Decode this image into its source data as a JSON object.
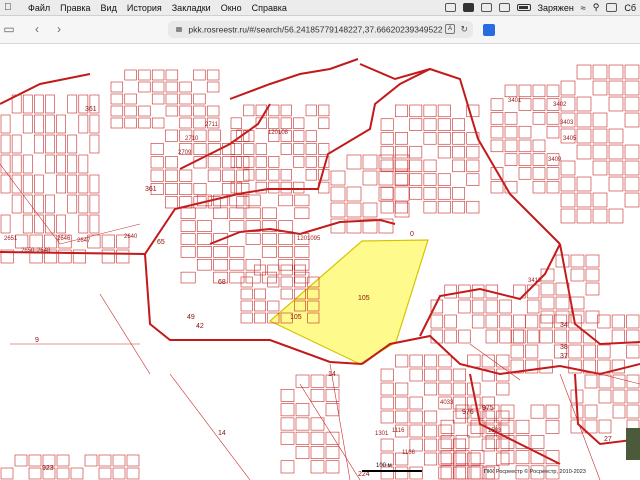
{
  "menubar": {
    "items": [
      "Файл",
      "Правка",
      "Вид",
      "История",
      "Закладки",
      "Окно",
      "Справка"
    ],
    "battery_text": "Заряжен",
    "right_clip": "Сб"
  },
  "browser": {
    "url": "pkk.rosreestr.ru/#/search/56.24185779148227,37.66620239349522"
  },
  "map": {
    "parcel_labels": [
      {
        "text": "361"
      },
      {
        "text": "361"
      },
      {
        "text": "65"
      },
      {
        "text": "9"
      },
      {
        "text": "14"
      },
      {
        "text": "14"
      },
      {
        "text": "105"
      },
      {
        "text": "105"
      },
      {
        "text": "0"
      },
      {
        "text": "68"
      },
      {
        "text": "42"
      },
      {
        "text": "49"
      },
      {
        "text": "2640"
      },
      {
        "text": "2646"
      },
      {
        "text": "2647"
      },
      {
        "text": "2648"
      },
      {
        "text": "2651"
      },
      {
        "text": "2650"
      },
      {
        "text": "120108"
      },
      {
        "text": "1201095"
      },
      {
        "text": "3402"
      },
      {
        "text": "3403"
      },
      {
        "text": "3405"
      },
      {
        "text": "3409"
      },
      {
        "text": "3401"
      },
      {
        "text": "3413"
      },
      {
        "text": "34"
      },
      {
        "text": "38"
      },
      {
        "text": "37"
      },
      {
        "text": "27"
      },
      {
        "text": "976"
      },
      {
        "text": "975"
      },
      {
        "text": "1593"
      },
      {
        "text": "1116"
      },
      {
        "text": "1166"
      },
      {
        "text": "923"
      },
      {
        "text": "224"
      },
      {
        "text": "1301"
      },
      {
        "text": "4033"
      },
      {
        "text": "2711"
      },
      {
        "text": "2710"
      },
      {
        "text": "2709"
      }
    ],
    "scale_text": "100 м",
    "attribution": "ПКК Росреестр © Росреестр, 2010-2023"
  }
}
